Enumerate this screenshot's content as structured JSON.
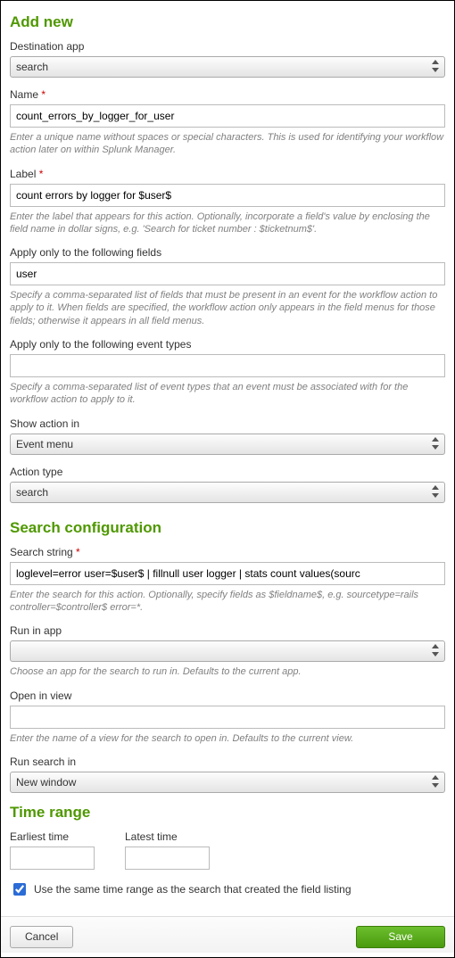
{
  "header": {
    "title": "Add new"
  },
  "fields": {
    "destination_app": {
      "label": "Destination app",
      "value": "search"
    },
    "name": {
      "label": "Name",
      "required_marker": "*",
      "value": "count_errors_by_logger_for_user",
      "help": "Enter a unique name without spaces or special characters. This is used for identifying your workflow action later on within Splunk Manager."
    },
    "label": {
      "label": "Label",
      "required_marker": "*",
      "value": "count errors by logger for $user$",
      "help": "Enter the label that appears for this action. Optionally, incorporate a field's value by enclosing the field name in dollar signs, e.g. 'Search for ticket number : $ticketnum$'."
    },
    "apply_fields": {
      "label": "Apply only to the following fields",
      "value": "user",
      "help": "Specify a comma-separated list of fields that must be present in an event for the workflow action to apply to it. When fields are specified, the workflow action only appears in the field menus for those fields; otherwise it appears in all field menus."
    },
    "apply_event_types": {
      "label": "Apply only to the following event types",
      "value": "",
      "help": "Specify a comma-separated list of event types that an event must be associated with for the workflow action to apply to it."
    },
    "show_action_in": {
      "label": "Show action in",
      "value": "Event menu"
    },
    "action_type": {
      "label": "Action type",
      "value": "search"
    }
  },
  "search_config": {
    "title": "Search configuration",
    "search_string": {
      "label": "Search string",
      "required_marker": "*",
      "value": "loglevel=error user=$user$ | fillnull user logger | stats count values(sourc",
      "help": "Enter the search for this action. Optionally, specify fields as $fieldname$, e.g. sourcetype=rails controller=$controller$ error=*."
    },
    "run_in_app": {
      "label": "Run in app",
      "value": "",
      "help": "Choose an app for the search to run in. Defaults to the current app."
    },
    "open_in_view": {
      "label": "Open in view",
      "value": "",
      "help": "Enter the name of a view for the search to open in. Defaults to the current view."
    },
    "run_search_in": {
      "label": "Run search in",
      "value": "New window"
    }
  },
  "time_range": {
    "title": "Time range",
    "earliest": {
      "label": "Earliest time",
      "value": ""
    },
    "latest": {
      "label": "Latest time",
      "value": ""
    },
    "same_range": {
      "checked": true,
      "label": "Use the same time range as the search that created the field listing"
    }
  },
  "footer": {
    "cancel": "Cancel",
    "save": "Save"
  }
}
